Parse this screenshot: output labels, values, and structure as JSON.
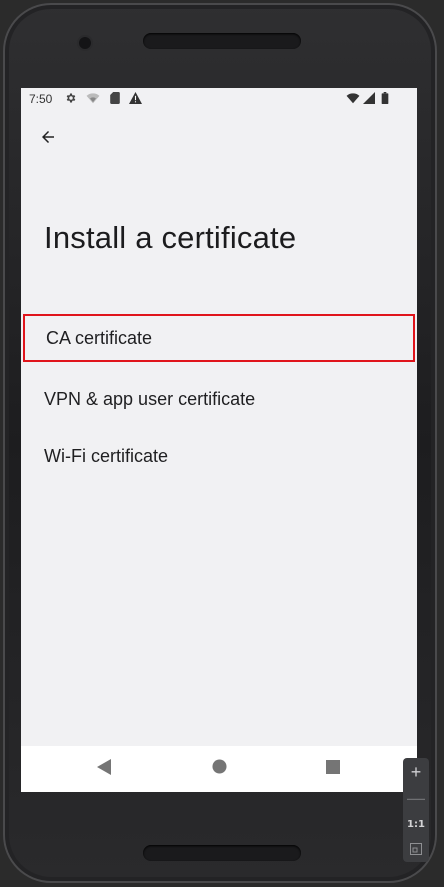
{
  "status_bar": {
    "time": "7:50",
    "left_icons": [
      "gear-icon",
      "wifi-off-icon",
      "sd-card-icon",
      "warning-icon"
    ],
    "right_icons": [
      "wifi-icon",
      "signal-icon",
      "battery-icon"
    ]
  },
  "header": {
    "back_icon": "arrow-left-icon"
  },
  "page": {
    "title": "Install a certificate"
  },
  "options": [
    {
      "label": "CA certificate",
      "highlighted": true
    },
    {
      "label": "VPN & app user certificate",
      "highlighted": false
    },
    {
      "label": "Wi-Fi certificate",
      "highlighted": false
    }
  ],
  "nav_bar": {
    "buttons": [
      "back-triangle-icon",
      "home-circle-icon",
      "recents-square-icon"
    ]
  },
  "zoom_panel": {
    "zoom_in": "+",
    "zoom_out": "—",
    "ratio": "1:1"
  },
  "colors": {
    "highlight": "#e0141b",
    "screen_bg": "#f1f1f3",
    "text": "#1f1f21"
  }
}
